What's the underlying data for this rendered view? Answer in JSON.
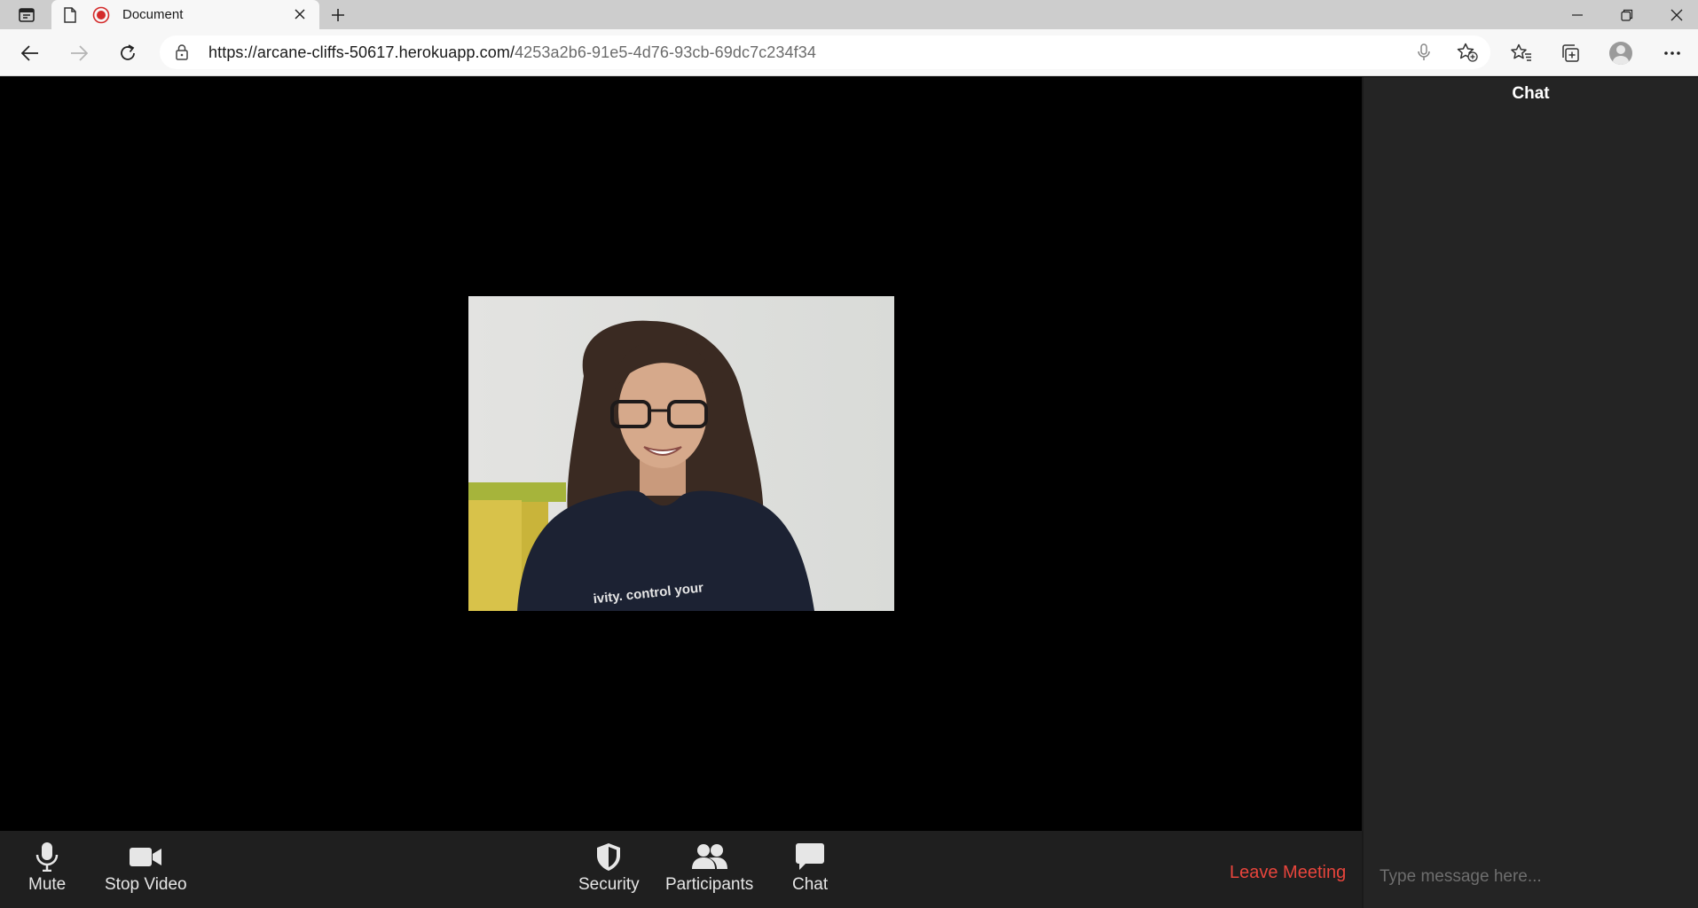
{
  "browser": {
    "tab_title": "Document",
    "url_host": "https://arcane-cliffs-50617.herokuapp.com/",
    "url_path": "4253a2b6-91e5-4d76-93cb-69dc7c234f34"
  },
  "video": {
    "shirt_text": "ivity. control your"
  },
  "chat": {
    "title": "Chat",
    "input_placeholder": "Type message here..."
  },
  "controls": {
    "mute": "Mute",
    "stop_video": "Stop Video",
    "security": "Security",
    "participants": "Participants",
    "chat": "Chat",
    "leave": "Leave Meeting"
  },
  "colors": {
    "leave_accent": "#e8453c",
    "record_red": "#d42b2b"
  }
}
